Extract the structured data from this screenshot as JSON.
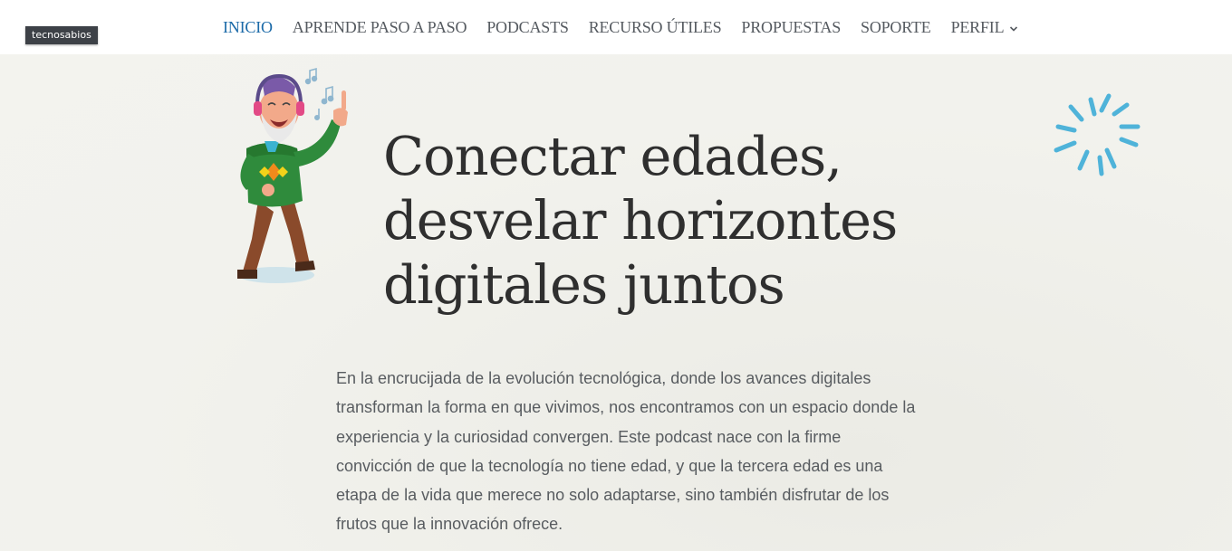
{
  "site": {
    "logo_label": "tecnosabios"
  },
  "nav": {
    "items": [
      {
        "label": "INICIO",
        "active": true
      },
      {
        "label": "APRENDE PASO A PASO",
        "active": false
      },
      {
        "label": "PODCASTS",
        "active": false
      },
      {
        "label": "RECURSO ÚTILES",
        "active": false
      },
      {
        "label": "PROPUESTAS",
        "active": false
      },
      {
        "label": "SOPORTE",
        "active": false
      },
      {
        "label": "PERFIL",
        "active": false,
        "has_dropdown": true
      }
    ]
  },
  "hero": {
    "headline_lines": [
      "Conectar edades,",
      "desvelar horizontes",
      "digitales juntos"
    ],
    "intro_lines": [
      "En la encrucijada de la evolución tecnológica, donde los avances digitales",
      "transforman la forma en que vivimos, nos encontramos con un espacio donde la",
      "experiencia y la curiosidad convergen. Este podcast nace con la firme",
      "convicción de que la tecnología no tiene edad, y que la tercera edad es una",
      "etapa de la vida que merece no solo adaptarse, sino también disfrutar de los",
      "frutos que la innovación ofrece."
    ],
    "illustration": "dancing-grandfather-with-headphones",
    "decoration": "sparkle-burst"
  },
  "colors": {
    "nav_active": "#1b6aa8",
    "nav_text": "#555a60",
    "background": "#f1f1ec",
    "headline": "#2f2f2f",
    "body_text": "#585c60",
    "burst": "#4fb3d9"
  }
}
